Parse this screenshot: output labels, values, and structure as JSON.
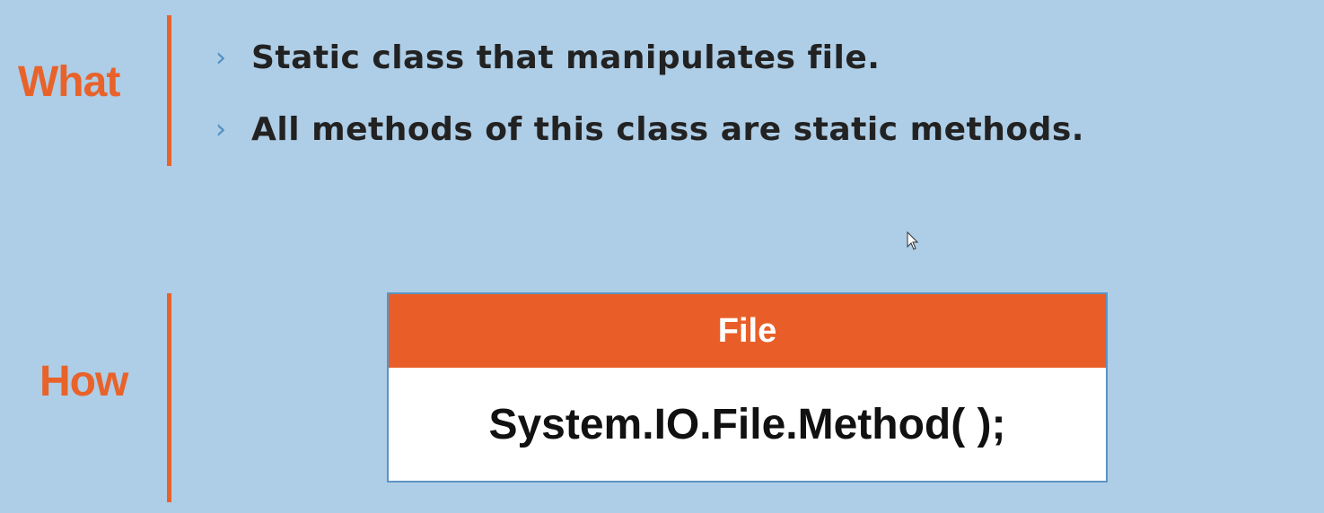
{
  "what": {
    "label": "What",
    "bullets": [
      "Static class that manipulates file.",
      "All methods of this class are static methods."
    ],
    "bullet_glyph": "›"
  },
  "how": {
    "label": "How",
    "box": {
      "header": "File",
      "body": "System.IO.File.Method( );"
    }
  },
  "colors": {
    "accent": "#e8622a",
    "background": "#aecde6",
    "bullet": "#4f8fc4",
    "text": "#222222"
  },
  "icons": {
    "cursor": "mouse-pointer-icon"
  }
}
